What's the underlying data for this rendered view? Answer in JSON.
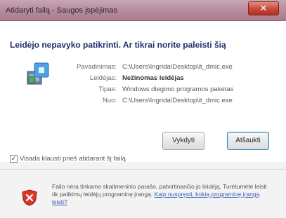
{
  "window": {
    "title": "Atidaryti failą - Saugos įspėjimas",
    "close_glyph": "✕"
  },
  "dialog": {
    "heading": "Leidėjo nepavyko patikrinti. Ar tikrai norite paleisti šią",
    "details": [
      {
        "label": "Pavadinimas:",
        "value": "C:\\Users\\Ingrida\\Desktop\\it_dmic.exe",
        "bold": false
      },
      {
        "label": "Leidėjas:",
        "value": "Nežinomas leidėjas",
        "bold": true
      },
      {
        "label": "Tipas:",
        "value": "Windows diegimo programos paketas",
        "bold": false
      },
      {
        "label": "Nuo:",
        "value": "C:\\Users\\Ingrida\\Desktop\\it_dmic.exe",
        "bold": false
      }
    ],
    "buttons": {
      "run": "Vykdyti",
      "cancel": "Atšaukti"
    },
    "always_ask": {
      "checked": true,
      "label": "Visada klausti prieš atidarant šį failą"
    },
    "warning": {
      "text": "Failo nėra tinkamo skaitmeninio parašo, patvirtinančio jo leidėją. Turėtumėte leisti tik patikimų leidėjų programinę įrangą.",
      "link": "Kaip nuspręsti, kokią programinę įrangą leisti?"
    }
  },
  "icons": {
    "app": "installer-package-icon",
    "warning": "security-warning-shield-icon"
  },
  "colors": {
    "titlebar": "#b88e9f",
    "heading": "#1f2d6a",
    "link": "#3a62b5",
    "close": "#c8473a"
  }
}
